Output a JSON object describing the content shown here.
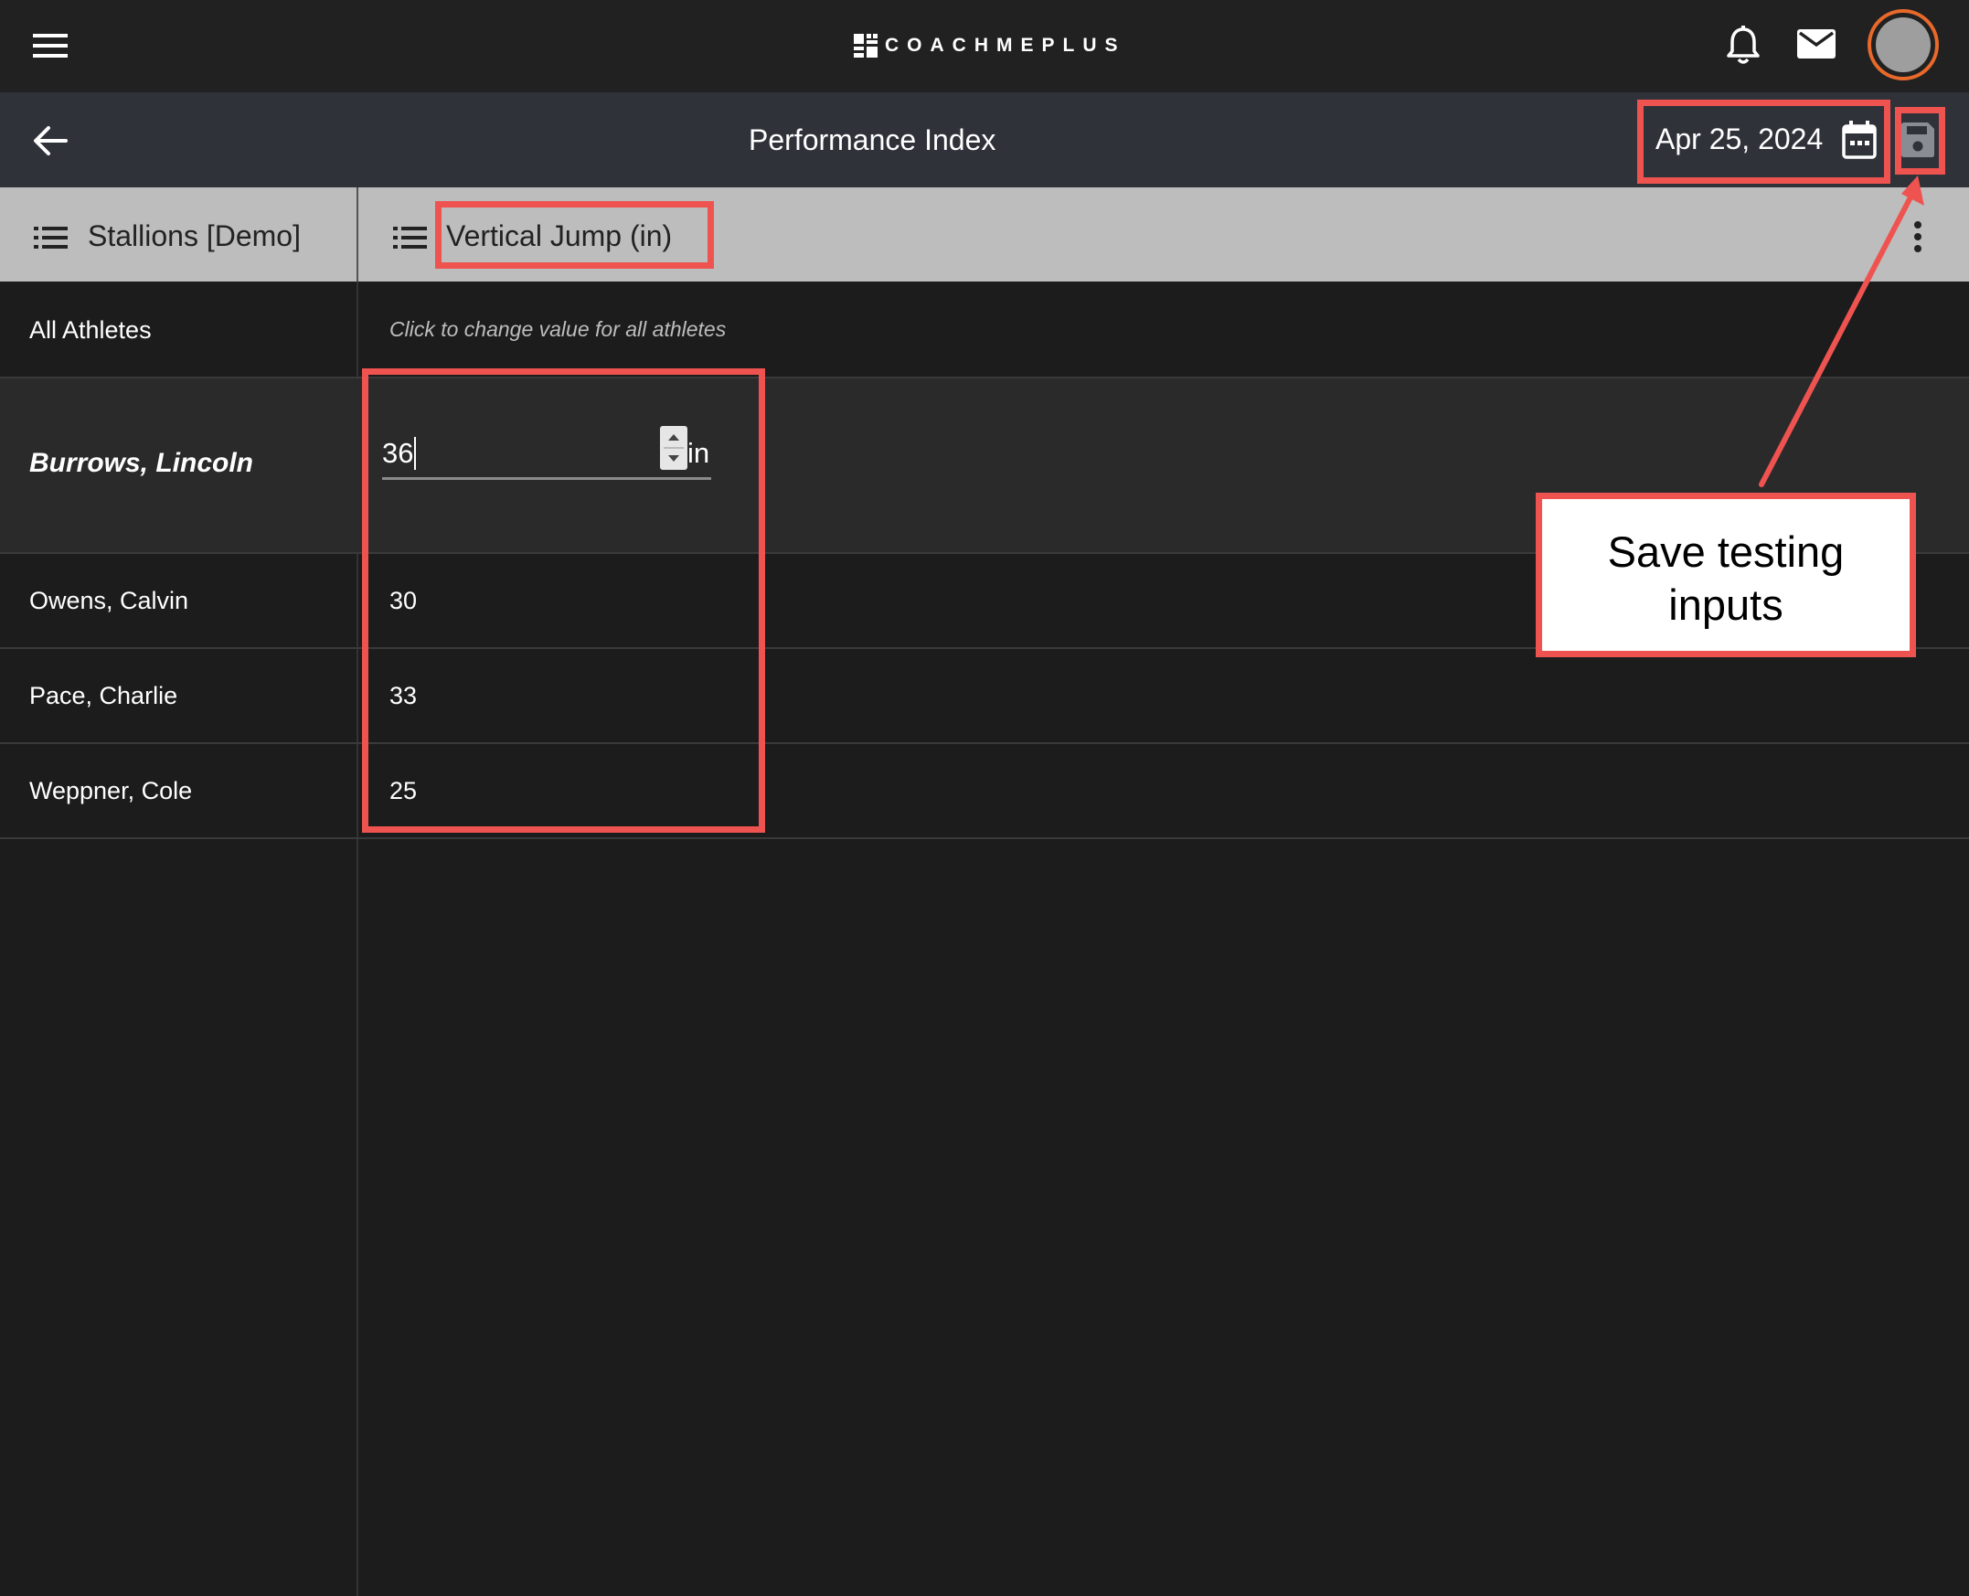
{
  "header": {
    "brand": "COACHMEPLUS",
    "icons": {
      "menu": "hamburger-menu-icon",
      "bell": "bell-icon",
      "mail": "mail-icon",
      "avatar": "avatar"
    }
  },
  "subheader": {
    "title": "Performance Index",
    "date": "Apr 25, 2024",
    "icons": {
      "back": "arrow-left-icon",
      "calendar": "calendar-icon",
      "save": "save-icon"
    }
  },
  "columns": {
    "team": "Stallions [Demo]",
    "metric": "Vertical Jump (in)"
  },
  "all_athletes": {
    "label": "All Athletes",
    "hint": "Click to change value for all athletes"
  },
  "athletes": [
    {
      "name": "Burrows, Lincoln",
      "value": "36",
      "unit": "in",
      "active": true
    },
    {
      "name": "Owens, Calvin",
      "value": "30"
    },
    {
      "name": "Pace, Charlie",
      "value": "33"
    },
    {
      "name": "Weppner, Cole",
      "value": "25"
    }
  ],
  "annotation": {
    "text_line1": "Save testing",
    "text_line2": "inputs",
    "color": "#ef5350"
  },
  "colors": {
    "topbar": "#212122",
    "subbar": "#30323a",
    "column_header": "#bdbdbd",
    "body": "#1c1c1d",
    "active_row": "#2a2a2b",
    "avatar_ring": "#e8692a"
  }
}
